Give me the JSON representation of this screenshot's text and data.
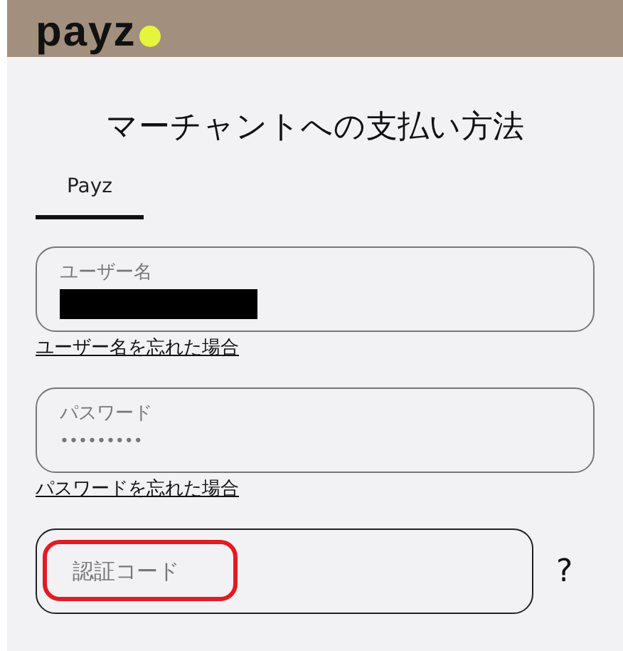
{
  "header": {
    "logo": "payz"
  },
  "title": "マーチャントへの支払い方法",
  "tabs": [
    {
      "label": "Payz",
      "selected": true
    }
  ],
  "username": {
    "label": "ユーザー名",
    "redacted": true,
    "link": "ユーザー名を忘れた場合"
  },
  "password": {
    "label": "パスワード",
    "value": "•••••••••",
    "link": "パスワードを忘れた場合"
  },
  "code": {
    "placeholder": "認証コード",
    "highlighted": true,
    "help": "?"
  }
}
